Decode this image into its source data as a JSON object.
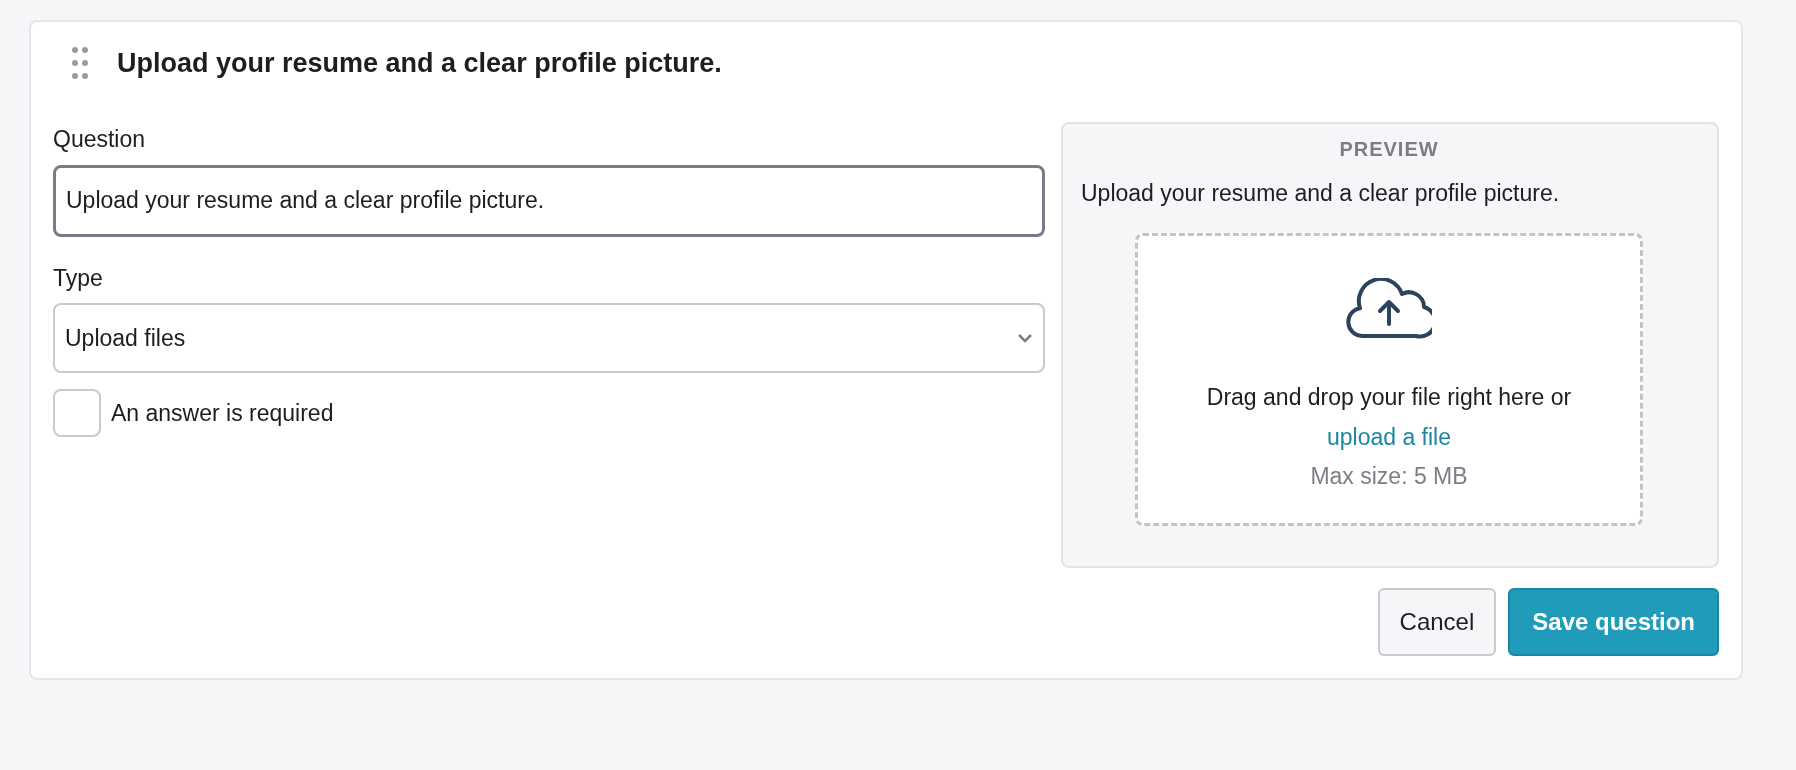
{
  "header": {
    "title": "Upload your resume and a clear profile picture."
  },
  "form": {
    "question_label": "Question",
    "question_value": "Upload your resume and a clear profile picture.",
    "type_label": "Type",
    "type_value": "Upload files",
    "required": {
      "label": "An answer is required",
      "checked": false
    }
  },
  "preview": {
    "heading": "PREVIEW",
    "question": "Upload your resume and a clear profile picture.",
    "dropzone": {
      "text": "Drag and drop your file right here or",
      "link": "upload a file",
      "limit": "Max size: 5 MB"
    }
  },
  "buttons": [
    {
      "label": "Cancel",
      "kind": "secondary"
    },
    {
      "label": "Save question",
      "kind": "primary"
    }
  ]
}
